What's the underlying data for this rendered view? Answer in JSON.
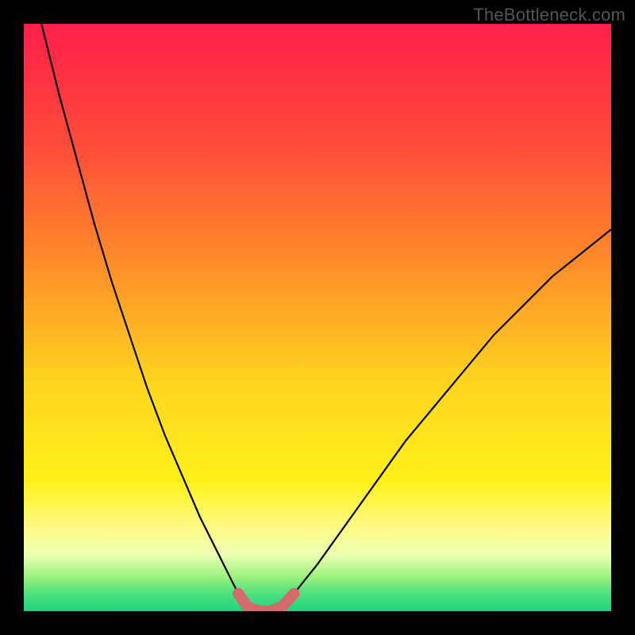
{
  "watermark": "TheBottleneck.com",
  "chart_data": {
    "type": "line",
    "title": "",
    "xlabel": "",
    "ylabel": "",
    "xlim": [
      0,
      100
    ],
    "ylim": [
      0,
      100
    ],
    "grid": false,
    "legend": false,
    "series": [
      {
        "name": "left-curve",
        "color": "#000000",
        "x": [
          3,
          6,
          9,
          12,
          15,
          18,
          21,
          24,
          27,
          30,
          33,
          35,
          36.5
        ],
        "y": [
          100,
          88,
          77,
          66,
          56,
          47,
          38,
          30,
          23,
          16,
          10,
          6,
          3
        ]
      },
      {
        "name": "right-curve",
        "color": "#000000",
        "x": [
          46,
          50,
          55,
          60,
          65,
          70,
          75,
          80,
          85,
          90,
          95,
          100
        ],
        "y": [
          3,
          8,
          15,
          22,
          29,
          35,
          41,
          47,
          52,
          57,
          61,
          65
        ]
      },
      {
        "name": "trough-highlight",
        "color": "#d46a6a",
        "x": [
          36.5,
          38,
          40,
          42,
          44,
          46
        ],
        "y": [
          3,
          0.8,
          0,
          0,
          0.8,
          3
        ]
      }
    ],
    "gradient_stops": [
      {
        "offset": 0.0,
        "color": "#ff1f4b"
      },
      {
        "offset": 0.2,
        "color": "#ff4a3a"
      },
      {
        "offset": 0.4,
        "color": "#ff8a2a"
      },
      {
        "offset": 0.6,
        "color": "#ffd21f"
      },
      {
        "offset": 0.78,
        "color": "#fff11a"
      },
      {
        "offset": 0.86,
        "color": "#fffb8a"
      },
      {
        "offset": 0.905,
        "color": "#eaffb0"
      },
      {
        "offset": 0.94,
        "color": "#9ff27f"
      },
      {
        "offset": 0.97,
        "color": "#4fe07f"
      },
      {
        "offset": 1.0,
        "color": "#1fd47f"
      }
    ]
  }
}
